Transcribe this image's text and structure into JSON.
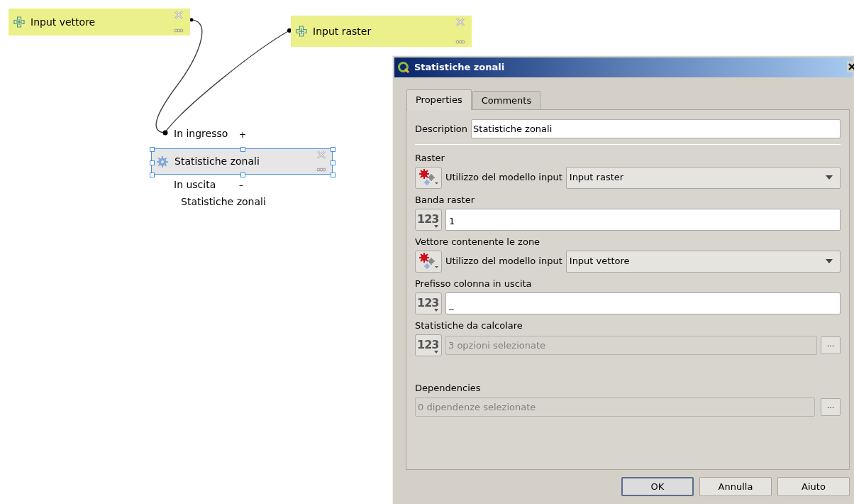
{
  "canvas": {
    "nodes": [
      {
        "kind": "input",
        "label": "Input vettore",
        "selected": false
      },
      {
        "kind": "input",
        "label": "Input raster",
        "selected": false
      },
      {
        "kind": "algorithm",
        "label": "Statistiche zonali",
        "selected": true,
        "inputs_label": "In ingresso",
        "inputs_toggle": "+",
        "outputs_label": "In uscita",
        "outputs_toggle": "–",
        "outputs": [
          "Statistiche zonali"
        ]
      }
    ]
  },
  "dialog": {
    "title": "Statistiche zonali",
    "tabs": [
      {
        "label": "Properties",
        "selected": true
      },
      {
        "label": "Comments",
        "selected": false
      }
    ],
    "description": {
      "label": "Description",
      "value": "Statistiche zonali"
    },
    "params": [
      {
        "kind": "model_input",
        "label": "Raster",
        "source": "Utilizzo del modello input",
        "value": "Input raster"
      },
      {
        "kind": "number",
        "label": "Banda raster",
        "icon_text": "123",
        "value": "1"
      },
      {
        "kind": "model_input",
        "label": "Vettore contenente le zone",
        "source": "Utilizzo del modello input",
        "value": "Input vettore"
      },
      {
        "kind": "number",
        "label": "Prefisso colonna in uscita",
        "icon_text": "123",
        "value": "_"
      },
      {
        "kind": "multi",
        "label": "Statistiche da calcolare",
        "icon_text": "123",
        "value": "3 opzioni selezionate",
        "button": "..."
      }
    ],
    "dependencies": {
      "label": "Dependencies",
      "value": "0 dipendenze selezionate",
      "button": "..."
    },
    "buttons": [
      {
        "label": "OK",
        "default": true
      },
      {
        "label": "Annulla",
        "default": false
      },
      {
        "label": "Aiuto",
        "default": false
      }
    ]
  }
}
